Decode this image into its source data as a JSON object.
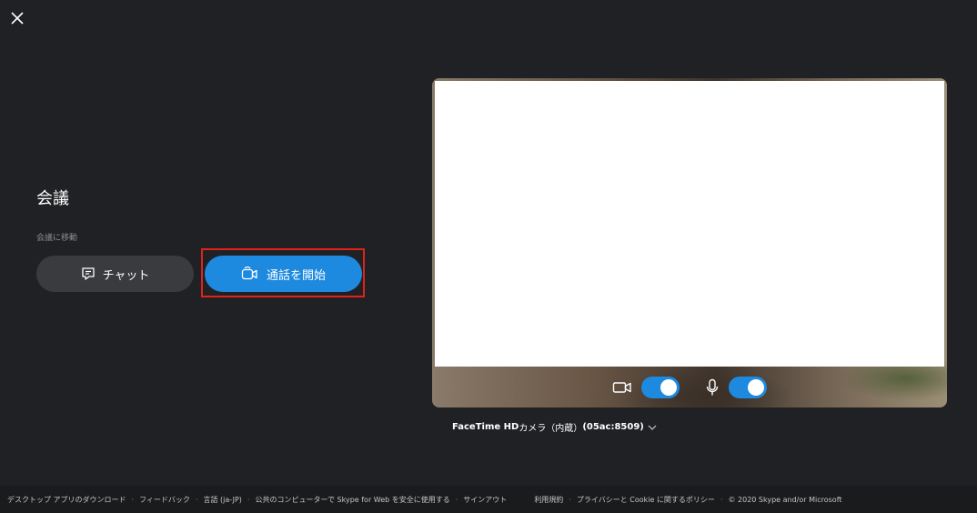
{
  "meeting": {
    "title": "会議",
    "go_to_label": "会議に移動",
    "chat_button": "チャット",
    "start_call_button": "通話を開始"
  },
  "preview": {
    "video_on": true,
    "mic_on": true,
    "camera_name": "FaceTime HD",
    "camera_detail": "カメラ（内蔵）",
    "camera_id": "(05ac:8509)"
  },
  "footer": {
    "links": [
      "デスクトップ アプリのダウンロード",
      "フィードバック",
      "言語 (ja-JP)",
      "公共のコンピューターで Skype for Web を安全に使用する",
      "サインアウト"
    ],
    "legal": [
      "利用規約",
      "プライバシーと Cookie に関するポリシー",
      "© 2020 Skype and/or Microsoft"
    ]
  },
  "colors": {
    "background": "#202124",
    "accent": "#1d8ae0",
    "highlight": "#e0231a"
  }
}
